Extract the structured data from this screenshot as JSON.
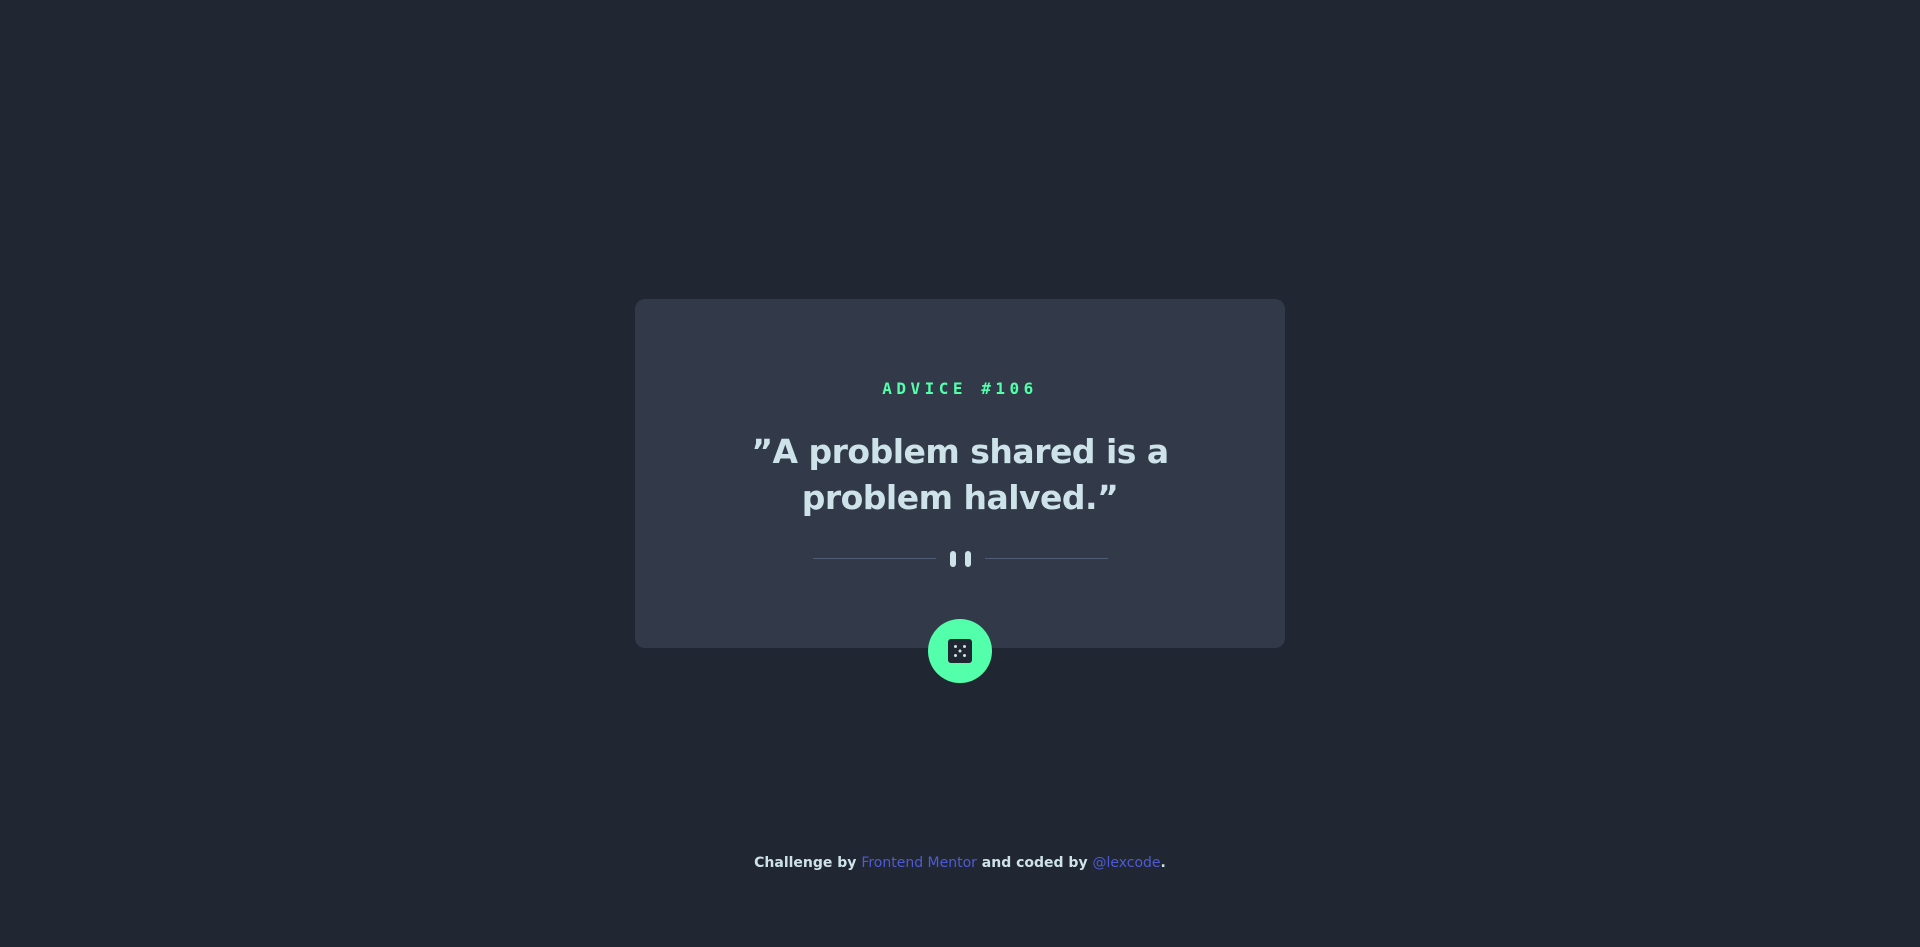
{
  "card": {
    "advice_label": "ADVICE #106",
    "quote": "”A problem shared is a problem halved.”",
    "divider_icon": "pause-icon"
  },
  "dice_button": {
    "icon": "dice-icon"
  },
  "attribution": {
    "prefix": "Challenge by",
    "link1": "Frontend Mentor",
    "middle": "and coded by",
    "link2": "@lexcode",
    "suffix": "."
  },
  "colors": {
    "background": "#202632",
    "card": "#323a49",
    "accent": "#53ffaa",
    "text": "#cee3e9",
    "link": "#4f5bd5"
  }
}
